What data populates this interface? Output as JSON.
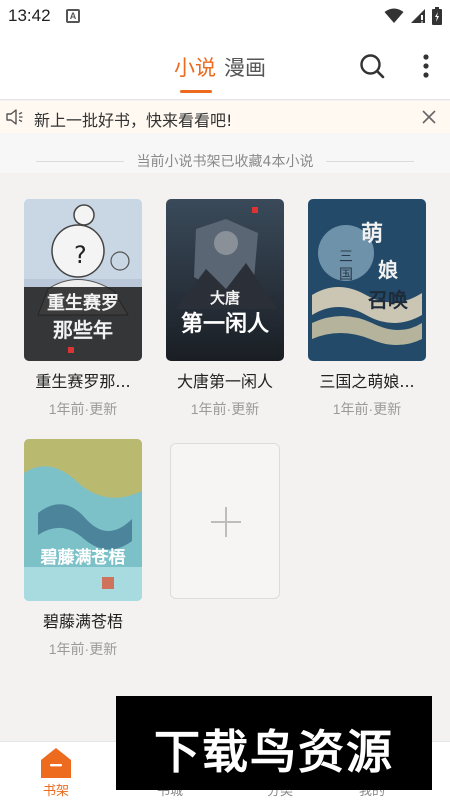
{
  "status_bar": {
    "time": "13:42",
    "notification_letter": "A"
  },
  "header": {
    "tabs": [
      {
        "label": "小说",
        "active": true
      },
      {
        "label": "漫画",
        "active": false
      }
    ]
  },
  "notice": {
    "text": "新上一批好书，快来看看吧!"
  },
  "shelf": {
    "summary": "当前小说书架已收藏4本小说"
  },
  "books": [
    {
      "title": "重生赛罗那...",
      "updated": "1年前·更新"
    },
    {
      "title": "大唐第一闲人",
      "updated": "1年前·更新"
    },
    {
      "title": "三国之萌娘...",
      "updated": "1年前·更新"
    },
    {
      "title": "碧藤满苍梧",
      "updated": "1年前·更新"
    }
  ],
  "bottom_nav": [
    {
      "label": "书架",
      "icon": "bookshelf-icon",
      "active": true
    },
    {
      "label": "书城",
      "icon": "bookstore-icon",
      "active": false
    },
    {
      "label": "分类",
      "icon": "category-icon",
      "active": false
    },
    {
      "label": "我的",
      "icon": "profile-icon",
      "active": false
    }
  ],
  "watermark": {
    "text": "下载鸟资源"
  },
  "colors": {
    "accent": "#ec6b1e",
    "background": "#f3f2f1",
    "notice_background": "#fff9f1"
  }
}
